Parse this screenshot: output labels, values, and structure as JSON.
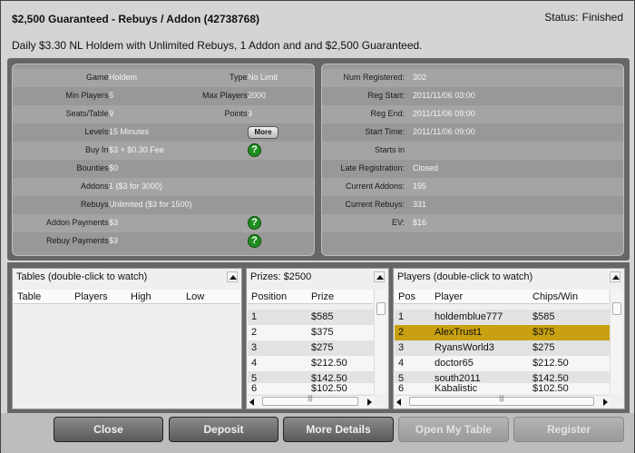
{
  "window": {
    "title": "$2,500 Guaranteed - Rebuys / Addon (42738768)",
    "status_label": "Status:",
    "status_value": "Finished",
    "description": "Daily $3.30 NL Holdem with Unlimited Rebuys, 1 Addon and and $2,500 Guaranteed."
  },
  "left_info": {
    "game_label": "Game:",
    "game_value": "Holdem",
    "type_label": "Type:",
    "type_value": "No Limit",
    "min_players_label": "Min Players:",
    "min_players_value": "5",
    "max_players_label": "Max Players:",
    "max_players_value": "2000",
    "seats_label": "Seats/Table:",
    "seats_value": "9",
    "points_label": "Points:",
    "points_value": "3",
    "levels_label": "Levels:",
    "levels_value": "15 Minutes",
    "more_label": "More",
    "buyin_label": "Buy In:",
    "buyin_value": "$3 + $0.30 Fee",
    "bounties_label": "Bounties:",
    "bounties_value": "$0",
    "addons_label": "Addons:",
    "addons_value": "1 ($3 for 3000)",
    "rebuys_label": "Rebuys:",
    "rebuys_value": "Unlimited ($3 for 1500)",
    "addon_payments_label": "Addon Payments:",
    "addon_payments_value": "$3",
    "rebuy_payments_label": "Rebuy Payments:",
    "rebuy_payments_value": "$3",
    "help_glyph": "?"
  },
  "right_info": {
    "num_registered_label": "Num Registered:",
    "num_registered_value": "302",
    "reg_start_label": "Reg Start:",
    "reg_start_value": "2011/11/06 03:00",
    "reg_end_label": "Reg End:",
    "reg_end_value": "2011/11/06 09:00",
    "start_time_label": "Start Time:",
    "start_time_value": "2011/11/06 09:00",
    "starts_in_label": "Starts in",
    "starts_in_value": "",
    "late_reg_label": "Late Registration:",
    "late_reg_value": "Closed",
    "current_addons_label": "Current Addons:",
    "current_addons_value": "195",
    "current_rebuys_label": "Current Rebuys:",
    "current_rebuys_value": "331",
    "ev_label": "EV:",
    "ev_value": "$16"
  },
  "tables_panel": {
    "title": "Tables (double-click to watch)",
    "columns": [
      "Table",
      "Players",
      "High",
      "Low"
    ]
  },
  "prizes_panel": {
    "title": "Prizes: $2500",
    "columns": [
      "Position",
      "Prize"
    ],
    "rows": [
      {
        "pos": "1",
        "prize": "$585"
      },
      {
        "pos": "2",
        "prize": "$375"
      },
      {
        "pos": "3",
        "prize": "$275"
      },
      {
        "pos": "4",
        "prize": "$212.50"
      },
      {
        "pos": "5",
        "prize": "$142.50"
      },
      {
        "pos": "6",
        "prize": "$102.50"
      }
    ]
  },
  "players_panel": {
    "title": "Players (double-click to watch)",
    "columns": [
      "Pos",
      "Player",
      "Chips/Win"
    ],
    "rows": [
      {
        "pos": "1",
        "player": "holdemblue777",
        "win": "$585"
      },
      {
        "pos": "2",
        "player": "AlexTrust1",
        "win": "$375"
      },
      {
        "pos": "3",
        "player": "RyansWorld3",
        "win": "$275"
      },
      {
        "pos": "4",
        "player": "doctor65",
        "win": "$212.50"
      },
      {
        "pos": "5",
        "player": "south2011",
        "win": "$142.50"
      },
      {
        "pos": "6",
        "player": "Kabalistic",
        "win": "$102.50"
      }
    ]
  },
  "buttons": {
    "close": "Close",
    "deposit": "Deposit",
    "more_details": "More Details",
    "open_my_table": "Open My Table",
    "register": "Register"
  },
  "colors": {
    "selected_row": "#c9a010",
    "help_icon": "#1f8f1f"
  }
}
